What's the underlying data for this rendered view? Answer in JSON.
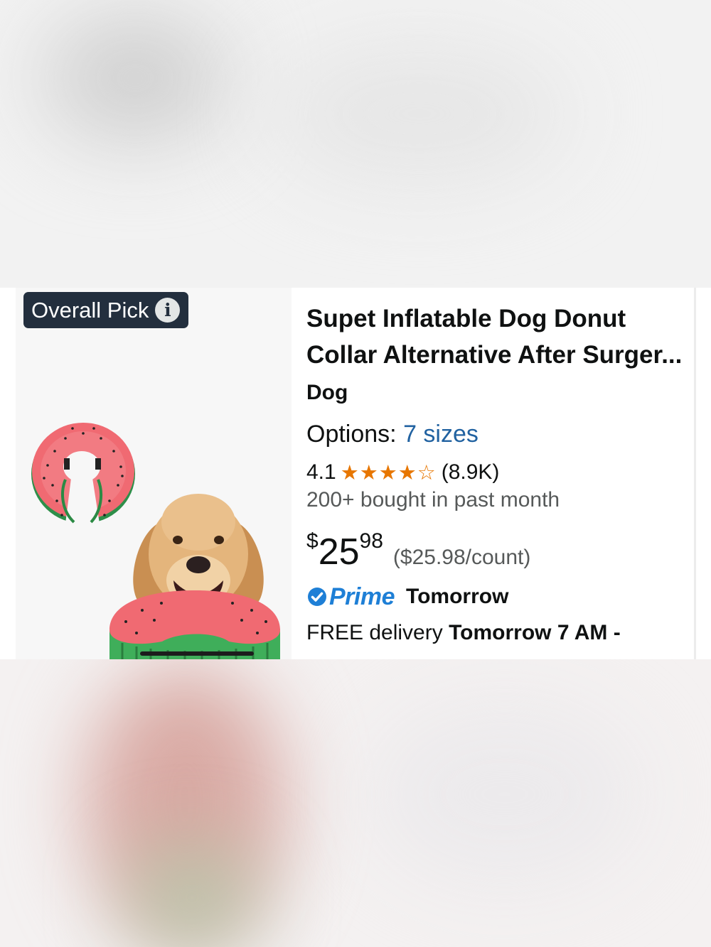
{
  "badge": {
    "label": "Overall Pick",
    "icon": "info-icon",
    "info_glyph": "i"
  },
  "product": {
    "title": "Supet Inflatable Dog Donut Collar Alternative After Surger...",
    "brand": "Dog",
    "options_label": "Options:",
    "options_link": "7 sizes",
    "rating": "4.1",
    "stars": 4.1,
    "stars_max": 5,
    "rating_count": "(8.9K)",
    "bought": "200+ bought in past month",
    "price_symbol": "$",
    "price_whole": "25",
    "price_fraction": "98",
    "unit_price": "($25.98/count)",
    "prime_label": "Prime",
    "prime_delivery": "Tomorrow",
    "delivery_prefix": "FREE delivery",
    "delivery_date": "Tomorrow 7 AM -"
  },
  "colors": {
    "badge_bg": "#232f3e",
    "link": "#2162a1",
    "star": "#e77600",
    "prime": "#1e7fd6",
    "watermelon_pink": "#f06a72",
    "watermelon_green": "#3fae5a"
  }
}
